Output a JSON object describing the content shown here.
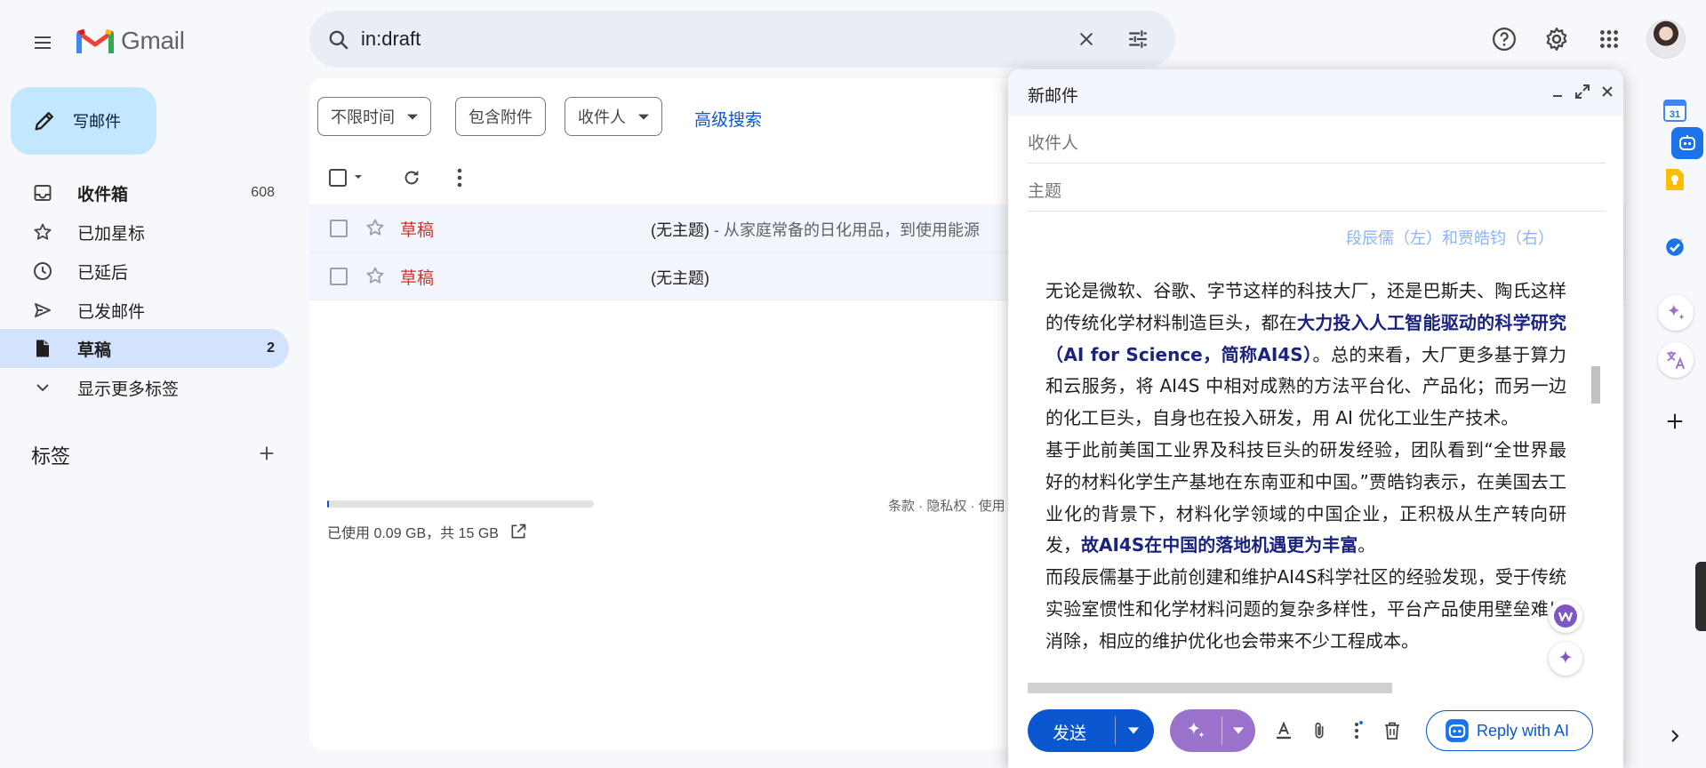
{
  "app": {
    "name": "Gmail",
    "search_value": "in:draft"
  },
  "nav": {
    "compose_label": "写邮件",
    "items": [
      {
        "label": "收件箱",
        "count": "608"
      },
      {
        "label": "已加星标",
        "count": ""
      },
      {
        "label": "已延后",
        "count": ""
      },
      {
        "label": "已发邮件",
        "count": ""
      },
      {
        "label": "草稿",
        "count": "2"
      },
      {
        "label": "显示更多标签",
        "count": ""
      }
    ],
    "labels_title": "标签"
  },
  "filters": {
    "time": "不限时间",
    "attachment": "包含附件",
    "recipient": "收件人",
    "advanced": "高级搜索"
  },
  "drafts": [
    {
      "sender": "草稿",
      "subject": "(无主题)",
      "snippet": " - 从家庭常备的日化用品，到使用能源"
    },
    {
      "sender": "草稿",
      "subject": "(无主题)",
      "snippet": ""
    }
  ],
  "footer": {
    "storage": "已使用 0.09 GB，共 15 GB",
    "storage_fraction": 0.006,
    "links": "条款 · 隐私权 · 使用"
  },
  "compose": {
    "title": "新邮件",
    "to_placeholder": "收件人",
    "subject_placeholder": "主题",
    "caption": "段辰儒（左）和贾皓钧（右）",
    "p1_a": "无论是微软、谷歌、字节这样的科技大厂，还是巴斯夫、陶氏这样的传统化学材料制造巨头，都在",
    "p1_hl": "大力投入人工智能驱动的科学研究（AI for Science，简称AI4S）",
    "p1_b": "。总的来看，大厂更多基于算力和云服务，将 AI4S 中相对成熟的方法平台化、产品化；而另一边的化工巨头，自身也在投入研发，用 AI 优化工业生产技术。",
    "p2_a": "基于此前美国工业界及科技巨头的研发经验，团队看到“全世界最好的材料化学生产基地在东南亚和中国。”贾皓钧表示，在美国去工业化的背景下，材料化学领域的中国企业，正积极从生产转向研发，",
    "p2_hl": "故AI4S在中国的落地机遇更为丰富",
    "p2_b": "。",
    "p3": "而段辰儒基于此前创建和维护AI4S科学社区的经验发现，受于传统实验室惯性和化学材料问题的复杂多样性，平台产品使用壁垒难以消除，相应的维护优化也会带来不少工程成本。",
    "send_label": "发送",
    "reply_ai_label": "Reply with AI"
  },
  "rail": {
    "calendar_day": "31"
  },
  "colors": {
    "accent_blue": "#0b57d0",
    "compose_bg": "#c2e7ff",
    "active_nav": "#d3e3fd",
    "draft_red": "#d93025",
    "ai_purple": "#9b72cb"
  }
}
